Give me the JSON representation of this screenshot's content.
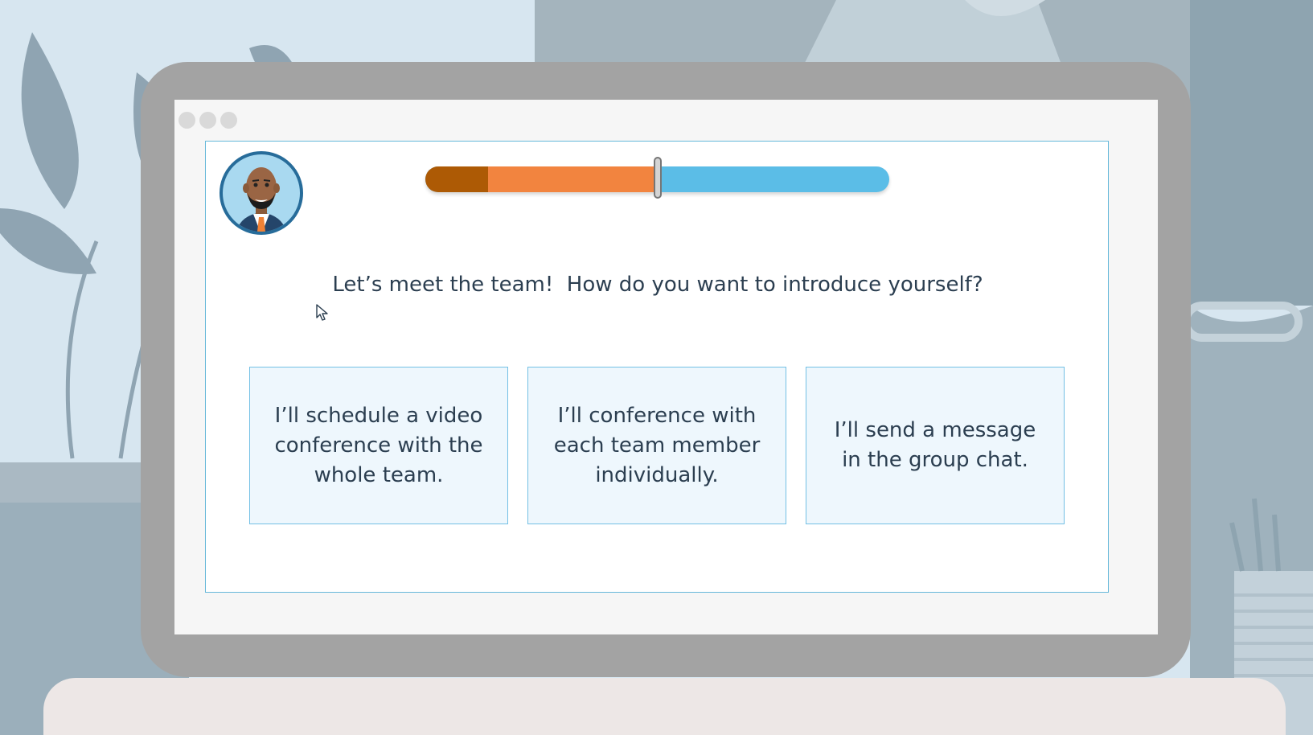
{
  "window": {
    "controls": [
      "window-dot",
      "window-dot",
      "window-dot"
    ]
  },
  "course": {
    "avatar_icon": "businessman-avatar-icon",
    "progress": {
      "completed_fraction": 0.135,
      "current_fraction": 0.495,
      "completed_color": "#ad5a05",
      "current_color": "#f2843f",
      "remaining_color": "#5bbde7"
    },
    "question": "Let’s meet the team!  How do you want to introduce yourself?",
    "answers": [
      {
        "label": "I’ll schedule a video conference with the whole team."
      },
      {
        "label": "I’ll conference with each team member individually."
      },
      {
        "label": "I’ll send a message in the group chat."
      }
    ]
  },
  "colors": {
    "accent": "#66b8d9",
    "text": "#2b3e50",
    "answer_background": "#eef7fd"
  }
}
